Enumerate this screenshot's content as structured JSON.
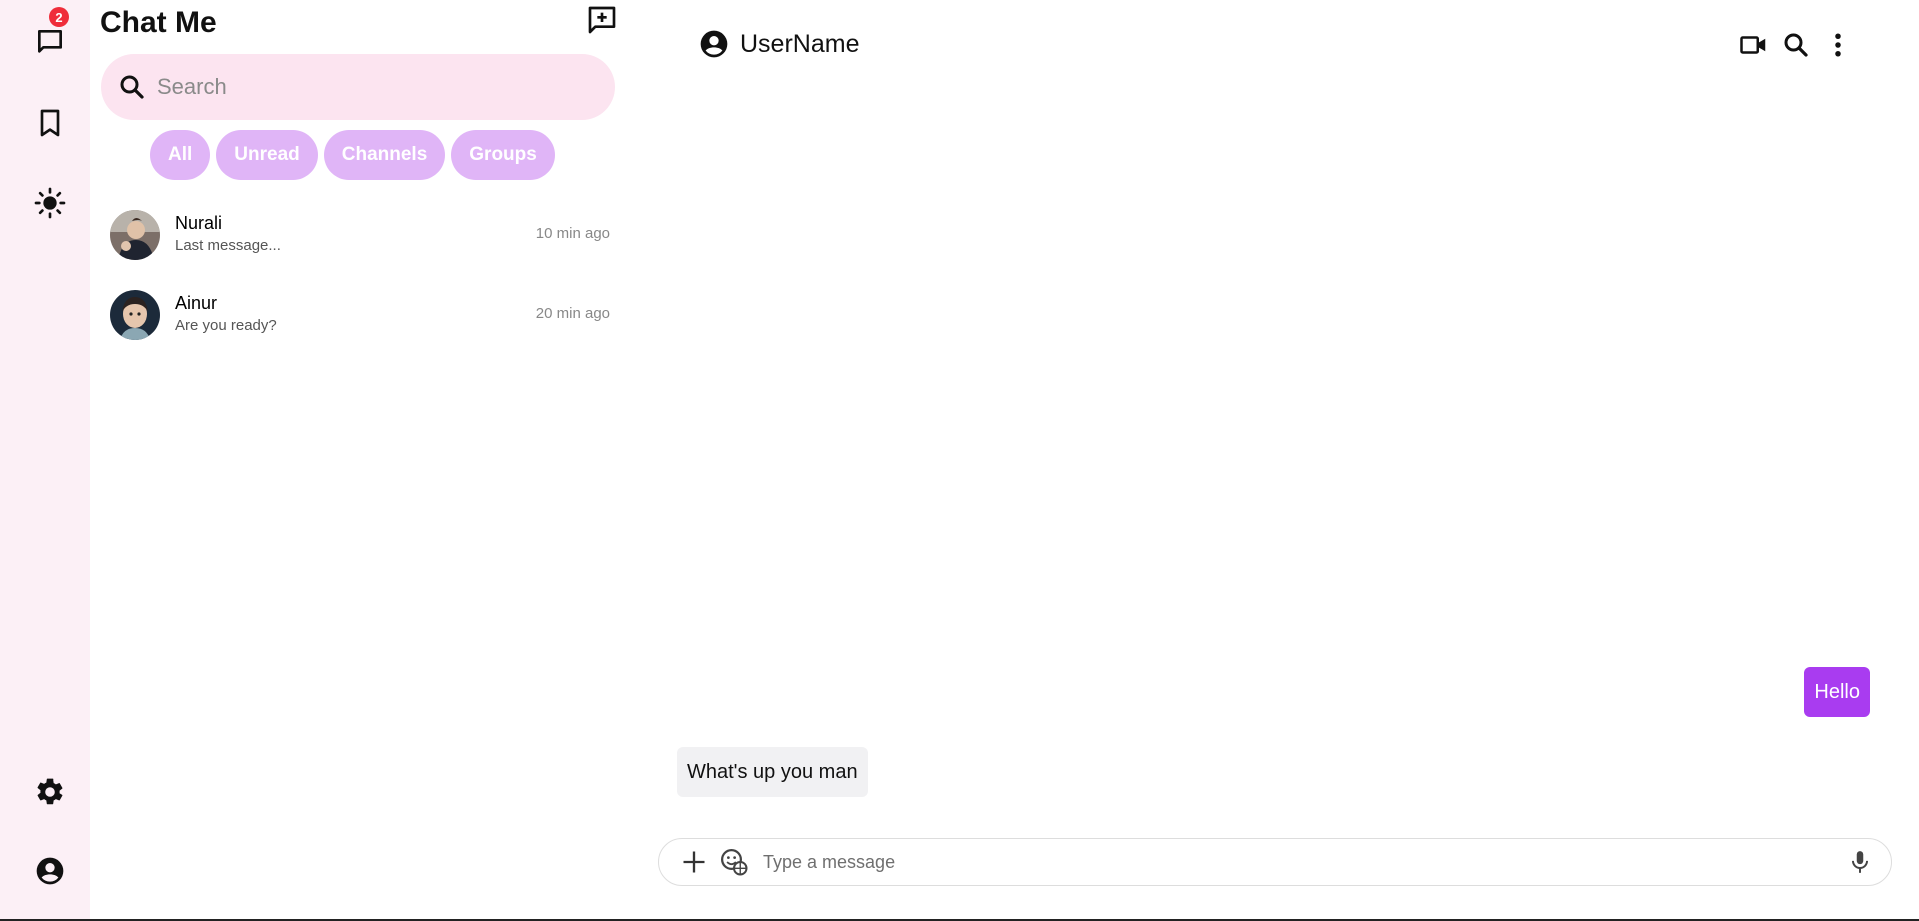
{
  "sidebar": {
    "chats_badge": "2",
    "items": [
      {
        "icon": "chat-bubble-icon"
      },
      {
        "icon": "bookmark-icon"
      },
      {
        "icon": "sun-icon"
      },
      {
        "icon": "gear-icon"
      },
      {
        "icon": "account-circle-icon"
      }
    ]
  },
  "chat_list": {
    "title": "Chat Me",
    "new_chat_icon": "new-chat-icon",
    "search_placeholder": "Search",
    "filters": [
      "All",
      "Unread",
      "Channels",
      "Groups"
    ],
    "chats": [
      {
        "name": "Nurali",
        "last_message": "Last message...",
        "time": "10 min ago"
      },
      {
        "name": "Ainur",
        "last_message": "Are you ready?",
        "time": "20 min ago"
      }
    ]
  },
  "conversation": {
    "username": "UserName",
    "messages": [
      {
        "direction": "outgoing",
        "text": "Hello"
      },
      {
        "direction": "incoming",
        "text": "What's up you man"
      }
    ],
    "composer_placeholder": "Type a message"
  },
  "colors": {
    "accent": "#a93cf0",
    "filter_chip": "#e0b5f7",
    "search_bg": "#fce4f0",
    "rail_bg": "#fcf0f6",
    "badge": "#ef2d3a"
  }
}
